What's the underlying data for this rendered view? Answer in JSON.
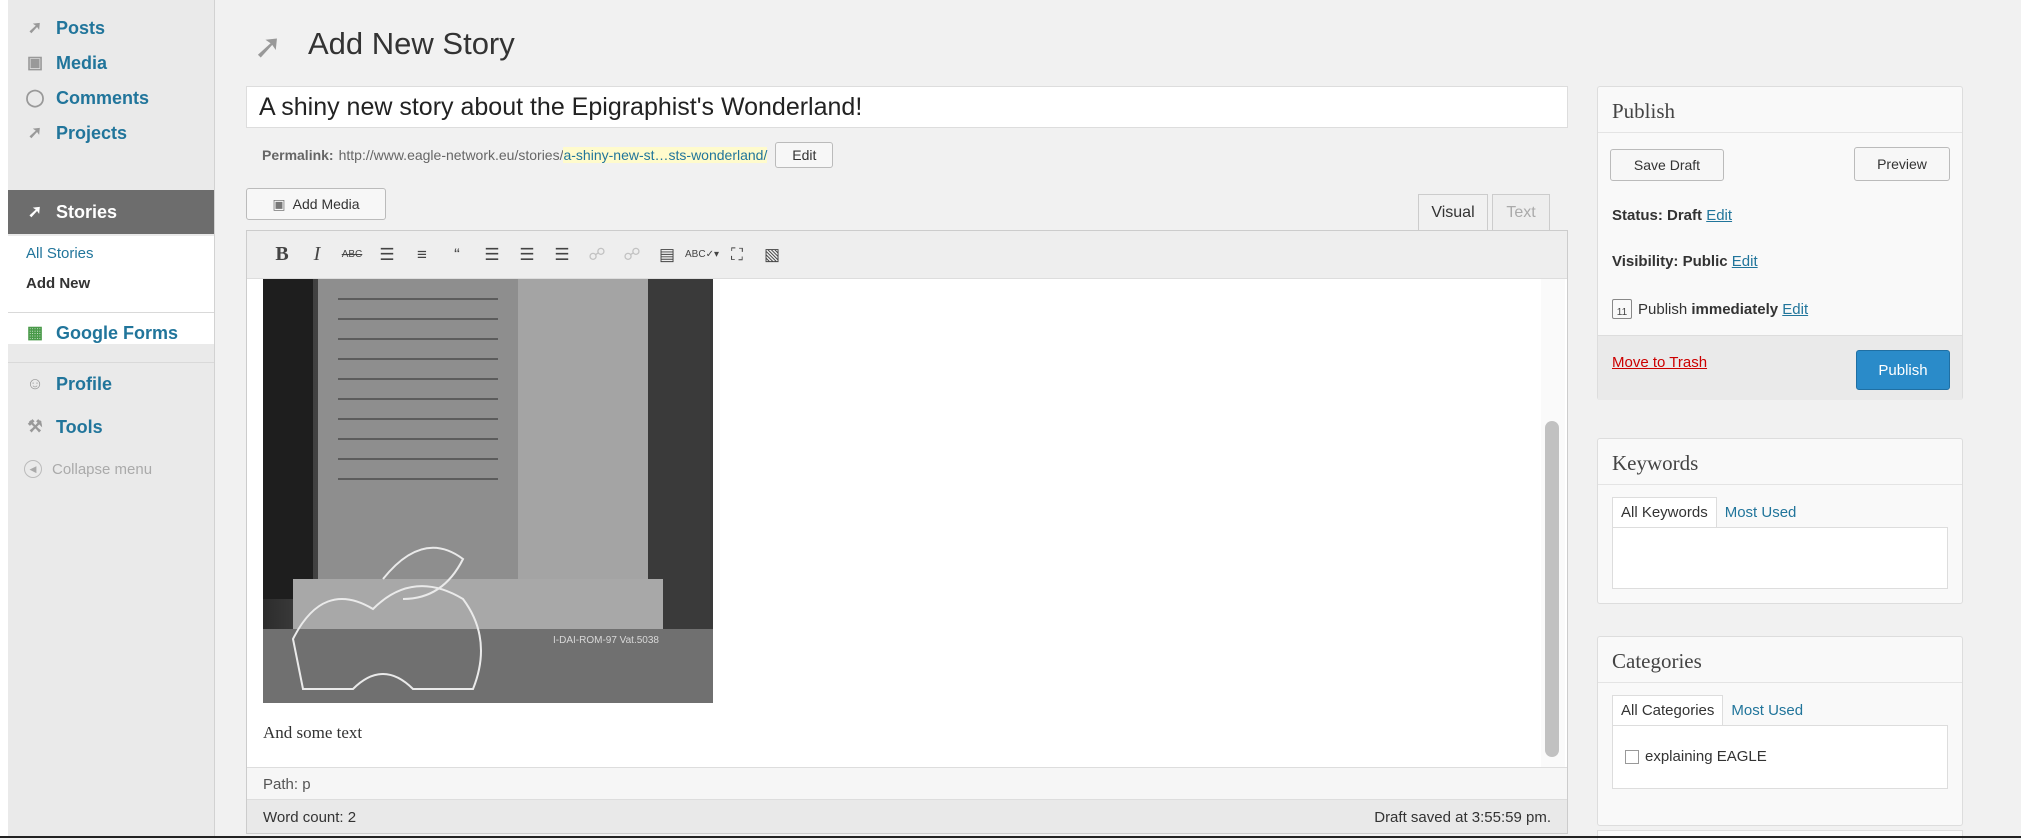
{
  "sidebar": {
    "items": [
      {
        "label": "Posts",
        "icon": "pin-icon"
      },
      {
        "label": "Media",
        "icon": "media-icon"
      },
      {
        "label": "Comments",
        "icon": "comment-icon"
      },
      {
        "label": "Projects",
        "icon": "pin-icon"
      },
      {
        "label": "Stories",
        "icon": "pin-icon",
        "active": true
      },
      {
        "label": "Google Forms",
        "icon": "form-icon"
      },
      {
        "label": "Profile",
        "icon": "users-icon"
      },
      {
        "label": "Tools",
        "icon": "tools-icon"
      }
    ],
    "submenu": [
      "All Stories",
      "Add New"
    ],
    "collapse_label": "Collapse menu"
  },
  "page": {
    "title": "Add New Story",
    "post_title": "A shiny new story about the Epigraphist's Wonderland!",
    "permalink_label": "Permalink:",
    "permalink_base": "http://www.eagle-network.eu/stories/",
    "permalink_slug": "a-shiny-new-st…sts-wonderland/",
    "permalink_edit": "Edit",
    "add_media": "Add Media",
    "tabs": [
      "Visual",
      "Text"
    ]
  },
  "editor": {
    "toolbar_icons": [
      "bold-icon",
      "italic-icon",
      "strikethrough-icon",
      "bullet-list-icon",
      "numbered-list-icon",
      "blockquote-icon",
      "align-left-icon",
      "align-center-icon",
      "align-right-icon",
      "link-icon",
      "unlink-icon",
      "more-tag-icon",
      "spellcheck-icon",
      "fullscreen-icon",
      "kitchen-sink-icon"
    ],
    "image_caption": "I-DAI-ROM-97 Vat.5038",
    "body_text": "And some text",
    "path": "Path: p",
    "word_count": "Word count: 2",
    "draft_saved": "Draft saved at 3:55:59 pm."
  },
  "publish": {
    "heading": "Publish",
    "save_draft": "Save Draft",
    "preview": "Preview",
    "status_label": "Status:",
    "status_value": "Draft",
    "visibility_label": "Visibility:",
    "visibility_value": "Public",
    "publish_label": "Publish",
    "publish_value": "immediately",
    "edit": "Edit",
    "trash": "Move to Trash",
    "publish_button": "Publish"
  },
  "keywords": {
    "heading": "Keywords",
    "tabs": [
      "All Keywords",
      "Most Used"
    ]
  },
  "categories": {
    "heading": "Categories",
    "tabs": [
      "All Categories",
      "Most Used"
    ],
    "items": [
      "explaining EAGLE"
    ]
  },
  "colors": {
    "link": "#21759b",
    "sidebar_active": "#6d6d6d",
    "publish_button": "#2a8bc9",
    "trash": "#cc0000"
  }
}
